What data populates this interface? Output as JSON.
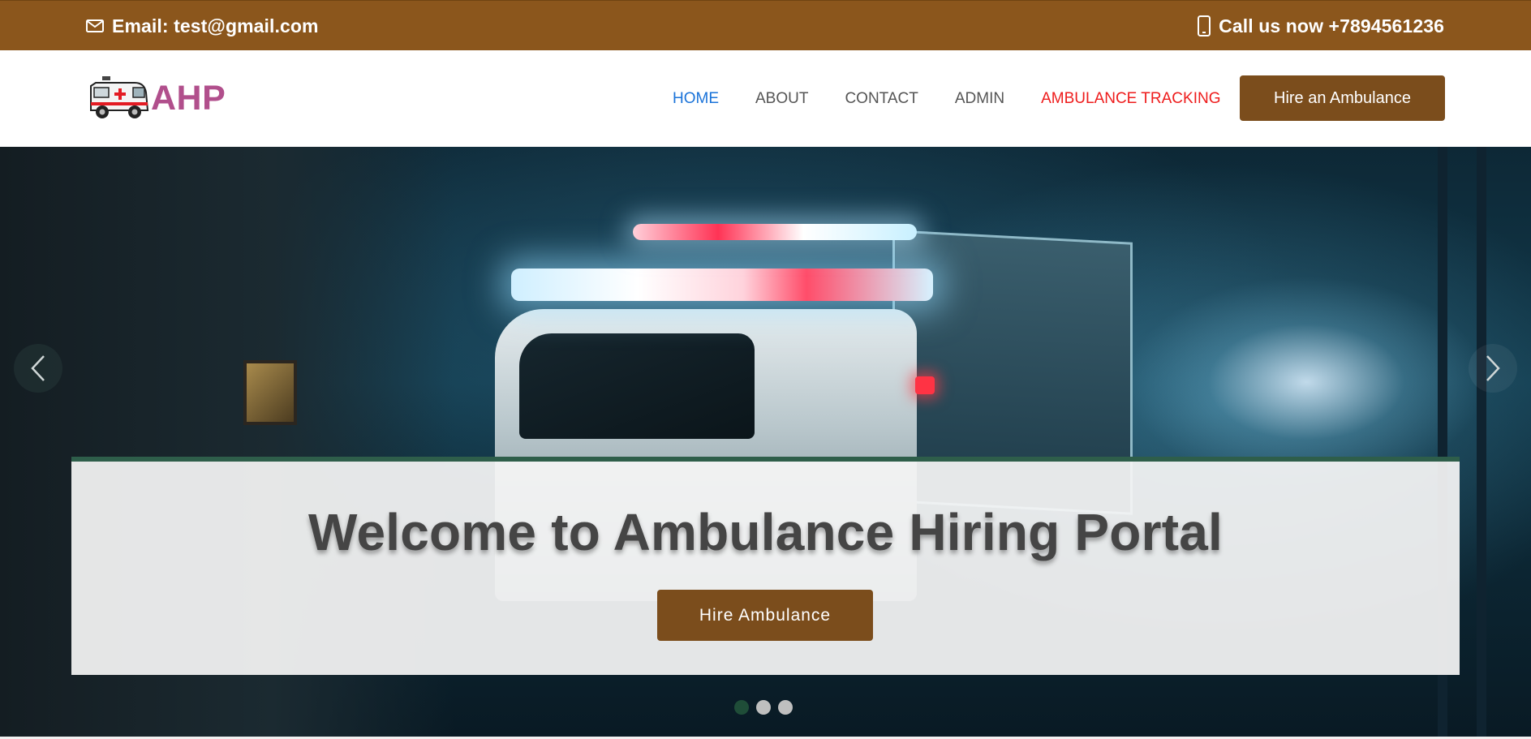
{
  "topbar": {
    "email_text": "Email: test@gmail.com",
    "email_icon": "envelope-icon",
    "phone_text": "Call us now +7894561236",
    "phone_icon": "mobile-phone-icon",
    "background_color": "#8b561c"
  },
  "header": {
    "logo_icon": "ambulance-icon",
    "logo_text": "AHP",
    "nav": [
      {
        "label": "HOME",
        "active": true
      },
      {
        "label": "ABOUT",
        "active": false
      },
      {
        "label": "CONTACT",
        "active": false
      },
      {
        "label": "ADMIN",
        "active": false
      },
      {
        "label": "AMBULANCE TRACKING",
        "active": false
      }
    ],
    "hire_button_label": "Hire an Ambulance",
    "accent_color": "#7b4d1c",
    "active_nav_color": "#1a73d9",
    "tracking_color": "#ee1c1c"
  },
  "hero": {
    "background_image": "ambulance-at-night-photo",
    "prev_icon": "chevron-left-icon",
    "next_icon": "chevron-right-icon",
    "caption_title": "Welcome to Ambulance Hiring Portal",
    "caption_button_label": "Hire Ambulance",
    "slide_count": 3,
    "active_slide": 1
  }
}
